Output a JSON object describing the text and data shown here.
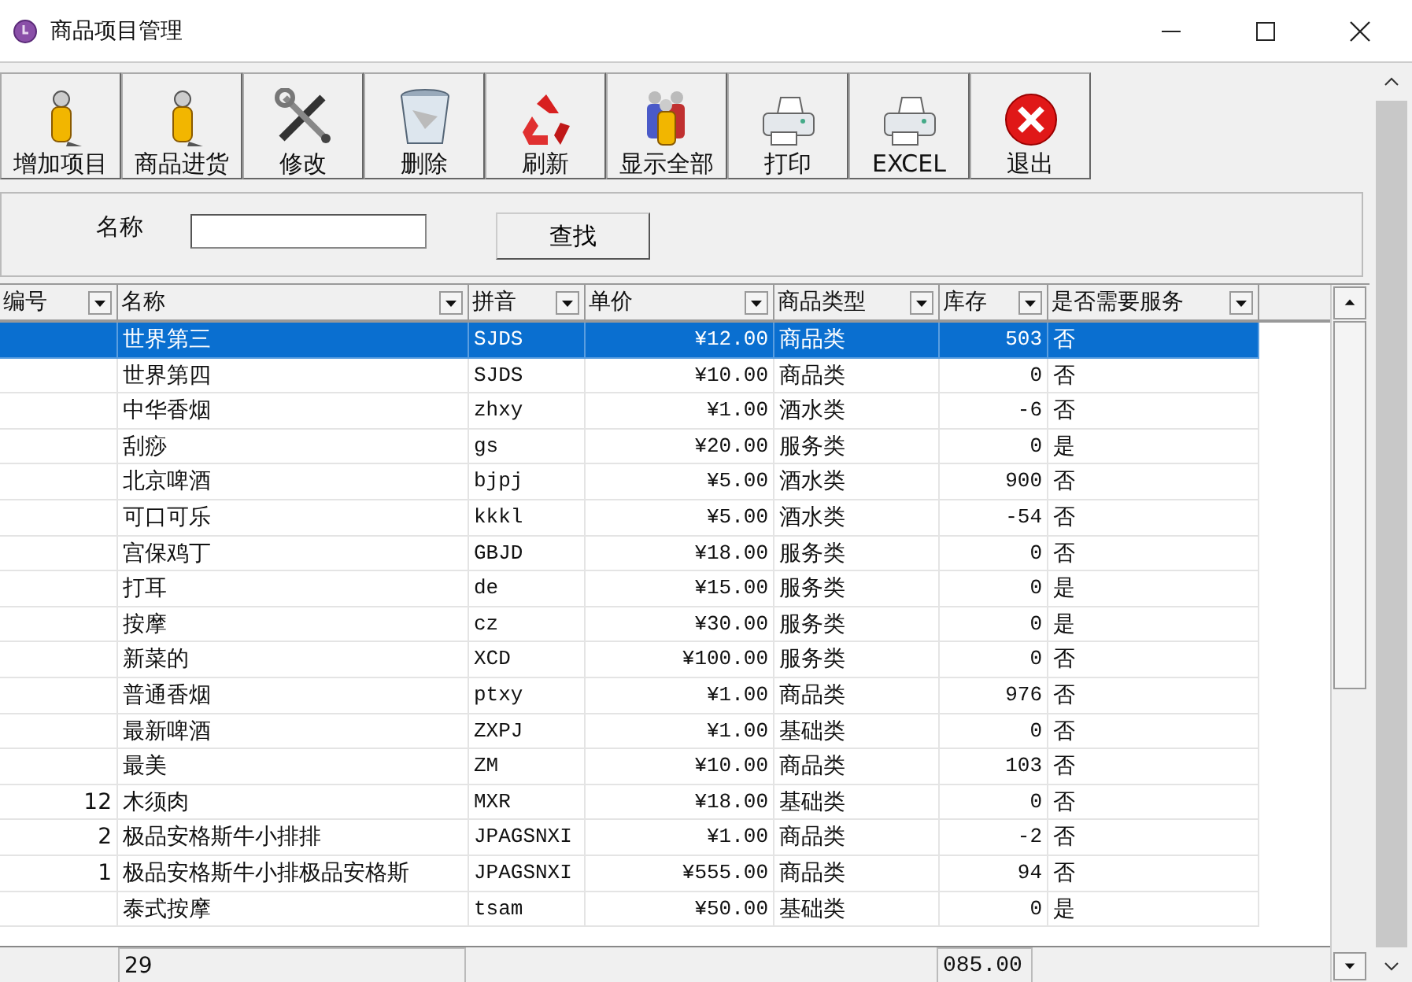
{
  "window": {
    "title": "商品项目管理"
  },
  "toolbar": [
    "增加项目",
    "商品进货",
    "修改",
    "删除",
    "刷新",
    "显示全部",
    "打印",
    "EXCEL",
    "退出"
  ],
  "search": {
    "label": "名称",
    "button": "查找"
  },
  "table": {
    "columns": [
      "编号",
      "名称",
      "拼音",
      "单价",
      "商品类型",
      "库存",
      "是否需要服务"
    ],
    "rows": [
      {
        "selected": true,
        "cells": [
          "",
          "世界第三",
          "SJDS",
          "¥12.00",
          "商品类",
          "503",
          "否"
        ]
      },
      {
        "selected": false,
        "cells": [
          "",
          "世界第四",
          "SJDS",
          "¥10.00",
          "商品类",
          "0",
          "否"
        ]
      },
      {
        "selected": false,
        "cells": [
          "",
          "中华香烟",
          "zhxy",
          "¥1.00",
          "酒水类",
          "-6",
          "否"
        ]
      },
      {
        "selected": false,
        "cells": [
          "",
          "刮痧",
          "gs",
          "¥20.00",
          "服务类",
          "0",
          "是"
        ]
      },
      {
        "selected": false,
        "cells": [
          "",
          "北京啤酒",
          "bjpj",
          "¥5.00",
          "酒水类",
          "900",
          "否"
        ]
      },
      {
        "selected": false,
        "cells": [
          "",
          "可口可乐",
          "kkkl",
          "¥5.00",
          "酒水类",
          "-54",
          "否"
        ]
      },
      {
        "selected": false,
        "cells": [
          "",
          "宫保鸡丁",
          "GBJD",
          "¥18.00",
          "服务类",
          "0",
          "否"
        ]
      },
      {
        "selected": false,
        "cells": [
          "",
          "打耳",
          "de",
          "¥15.00",
          "服务类",
          "0",
          "是"
        ]
      },
      {
        "selected": false,
        "cells": [
          "",
          "按摩",
          "cz",
          "¥30.00",
          "服务类",
          "0",
          "是"
        ]
      },
      {
        "selected": false,
        "cells": [
          "",
          "新菜的",
          "XCD",
          "¥100.00",
          "服务类",
          "0",
          "否"
        ]
      },
      {
        "selected": false,
        "cells": [
          "",
          "普通香烟",
          "ptxy",
          "¥1.00",
          "商品类",
          "976",
          "否"
        ]
      },
      {
        "selected": false,
        "cells": [
          "",
          "最新啤酒",
          "ZXPJ",
          "¥1.00",
          "基础类",
          "0",
          "否"
        ]
      },
      {
        "selected": false,
        "cells": [
          "",
          "最美",
          "ZM",
          "¥10.00",
          "商品类",
          "103",
          "否"
        ]
      },
      {
        "selected": false,
        "cells": [
          "12",
          "木须肉",
          "MXR",
          "¥18.00",
          "基础类",
          "0",
          "否"
        ]
      },
      {
        "selected": false,
        "cells": [
          "2",
          "极品安格斯牛小排排",
          "JPAGSNXI",
          "¥1.00",
          "商品类",
          "-2",
          "否"
        ]
      },
      {
        "selected": false,
        "cells": [
          "1",
          "极品安格斯牛小排极品安格斯",
          "JPAGSNXI",
          "¥555.00",
          "商品类",
          "94",
          "否"
        ]
      },
      {
        "selected": false,
        "cells": [
          "",
          "泰式按摩",
          "tsam",
          "¥50.00",
          "基础类",
          "0",
          "是"
        ]
      }
    ]
  },
  "footer": {
    "count": "29",
    "total": "085.00"
  }
}
